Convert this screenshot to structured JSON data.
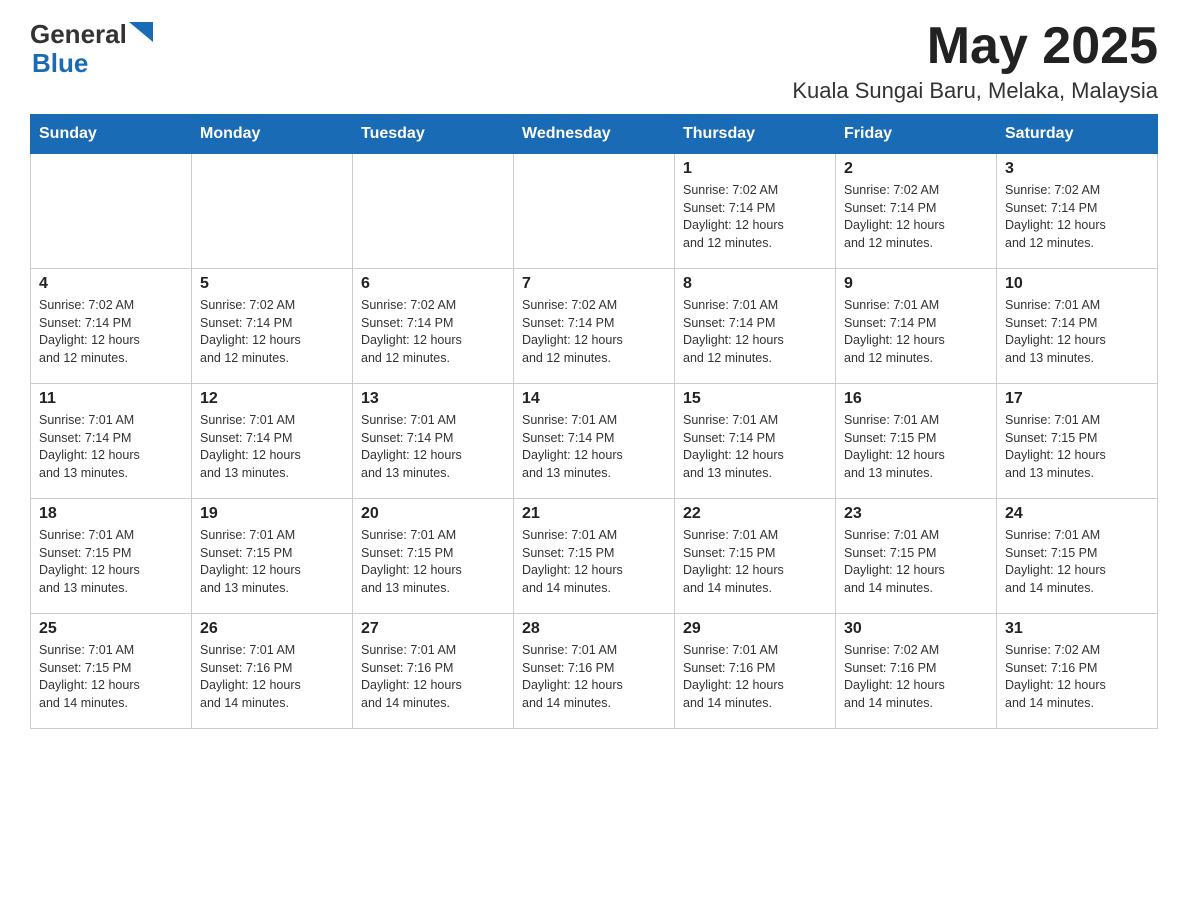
{
  "header": {
    "logo_general": "General",
    "logo_blue": "Blue",
    "month_title": "May 2025",
    "location": "Kuala Sungai Baru, Melaka, Malaysia"
  },
  "weekdays": [
    "Sunday",
    "Monday",
    "Tuesday",
    "Wednesday",
    "Thursday",
    "Friday",
    "Saturday"
  ],
  "weeks": [
    [
      {
        "day": "",
        "info": ""
      },
      {
        "day": "",
        "info": ""
      },
      {
        "day": "",
        "info": ""
      },
      {
        "day": "",
        "info": ""
      },
      {
        "day": "1",
        "info": "Sunrise: 7:02 AM\nSunset: 7:14 PM\nDaylight: 12 hours\nand 12 minutes."
      },
      {
        "day": "2",
        "info": "Sunrise: 7:02 AM\nSunset: 7:14 PM\nDaylight: 12 hours\nand 12 minutes."
      },
      {
        "day": "3",
        "info": "Sunrise: 7:02 AM\nSunset: 7:14 PM\nDaylight: 12 hours\nand 12 minutes."
      }
    ],
    [
      {
        "day": "4",
        "info": "Sunrise: 7:02 AM\nSunset: 7:14 PM\nDaylight: 12 hours\nand 12 minutes."
      },
      {
        "day": "5",
        "info": "Sunrise: 7:02 AM\nSunset: 7:14 PM\nDaylight: 12 hours\nand 12 minutes."
      },
      {
        "day": "6",
        "info": "Sunrise: 7:02 AM\nSunset: 7:14 PM\nDaylight: 12 hours\nand 12 minutes."
      },
      {
        "day": "7",
        "info": "Sunrise: 7:02 AM\nSunset: 7:14 PM\nDaylight: 12 hours\nand 12 minutes."
      },
      {
        "day": "8",
        "info": "Sunrise: 7:01 AM\nSunset: 7:14 PM\nDaylight: 12 hours\nand 12 minutes."
      },
      {
        "day": "9",
        "info": "Sunrise: 7:01 AM\nSunset: 7:14 PM\nDaylight: 12 hours\nand 12 minutes."
      },
      {
        "day": "10",
        "info": "Sunrise: 7:01 AM\nSunset: 7:14 PM\nDaylight: 12 hours\nand 13 minutes."
      }
    ],
    [
      {
        "day": "11",
        "info": "Sunrise: 7:01 AM\nSunset: 7:14 PM\nDaylight: 12 hours\nand 13 minutes."
      },
      {
        "day": "12",
        "info": "Sunrise: 7:01 AM\nSunset: 7:14 PM\nDaylight: 12 hours\nand 13 minutes."
      },
      {
        "day": "13",
        "info": "Sunrise: 7:01 AM\nSunset: 7:14 PM\nDaylight: 12 hours\nand 13 minutes."
      },
      {
        "day": "14",
        "info": "Sunrise: 7:01 AM\nSunset: 7:14 PM\nDaylight: 12 hours\nand 13 minutes."
      },
      {
        "day": "15",
        "info": "Sunrise: 7:01 AM\nSunset: 7:14 PM\nDaylight: 12 hours\nand 13 minutes."
      },
      {
        "day": "16",
        "info": "Sunrise: 7:01 AM\nSunset: 7:15 PM\nDaylight: 12 hours\nand 13 minutes."
      },
      {
        "day": "17",
        "info": "Sunrise: 7:01 AM\nSunset: 7:15 PM\nDaylight: 12 hours\nand 13 minutes."
      }
    ],
    [
      {
        "day": "18",
        "info": "Sunrise: 7:01 AM\nSunset: 7:15 PM\nDaylight: 12 hours\nand 13 minutes."
      },
      {
        "day": "19",
        "info": "Sunrise: 7:01 AM\nSunset: 7:15 PM\nDaylight: 12 hours\nand 13 minutes."
      },
      {
        "day": "20",
        "info": "Sunrise: 7:01 AM\nSunset: 7:15 PM\nDaylight: 12 hours\nand 13 minutes."
      },
      {
        "day": "21",
        "info": "Sunrise: 7:01 AM\nSunset: 7:15 PM\nDaylight: 12 hours\nand 14 minutes."
      },
      {
        "day": "22",
        "info": "Sunrise: 7:01 AM\nSunset: 7:15 PM\nDaylight: 12 hours\nand 14 minutes."
      },
      {
        "day": "23",
        "info": "Sunrise: 7:01 AM\nSunset: 7:15 PM\nDaylight: 12 hours\nand 14 minutes."
      },
      {
        "day": "24",
        "info": "Sunrise: 7:01 AM\nSunset: 7:15 PM\nDaylight: 12 hours\nand 14 minutes."
      }
    ],
    [
      {
        "day": "25",
        "info": "Sunrise: 7:01 AM\nSunset: 7:15 PM\nDaylight: 12 hours\nand 14 minutes."
      },
      {
        "day": "26",
        "info": "Sunrise: 7:01 AM\nSunset: 7:16 PM\nDaylight: 12 hours\nand 14 minutes."
      },
      {
        "day": "27",
        "info": "Sunrise: 7:01 AM\nSunset: 7:16 PM\nDaylight: 12 hours\nand 14 minutes."
      },
      {
        "day": "28",
        "info": "Sunrise: 7:01 AM\nSunset: 7:16 PM\nDaylight: 12 hours\nand 14 minutes."
      },
      {
        "day": "29",
        "info": "Sunrise: 7:01 AM\nSunset: 7:16 PM\nDaylight: 12 hours\nand 14 minutes."
      },
      {
        "day": "30",
        "info": "Sunrise: 7:02 AM\nSunset: 7:16 PM\nDaylight: 12 hours\nand 14 minutes."
      },
      {
        "day": "31",
        "info": "Sunrise: 7:02 AM\nSunset: 7:16 PM\nDaylight: 12 hours\nand 14 minutes."
      }
    ]
  ]
}
